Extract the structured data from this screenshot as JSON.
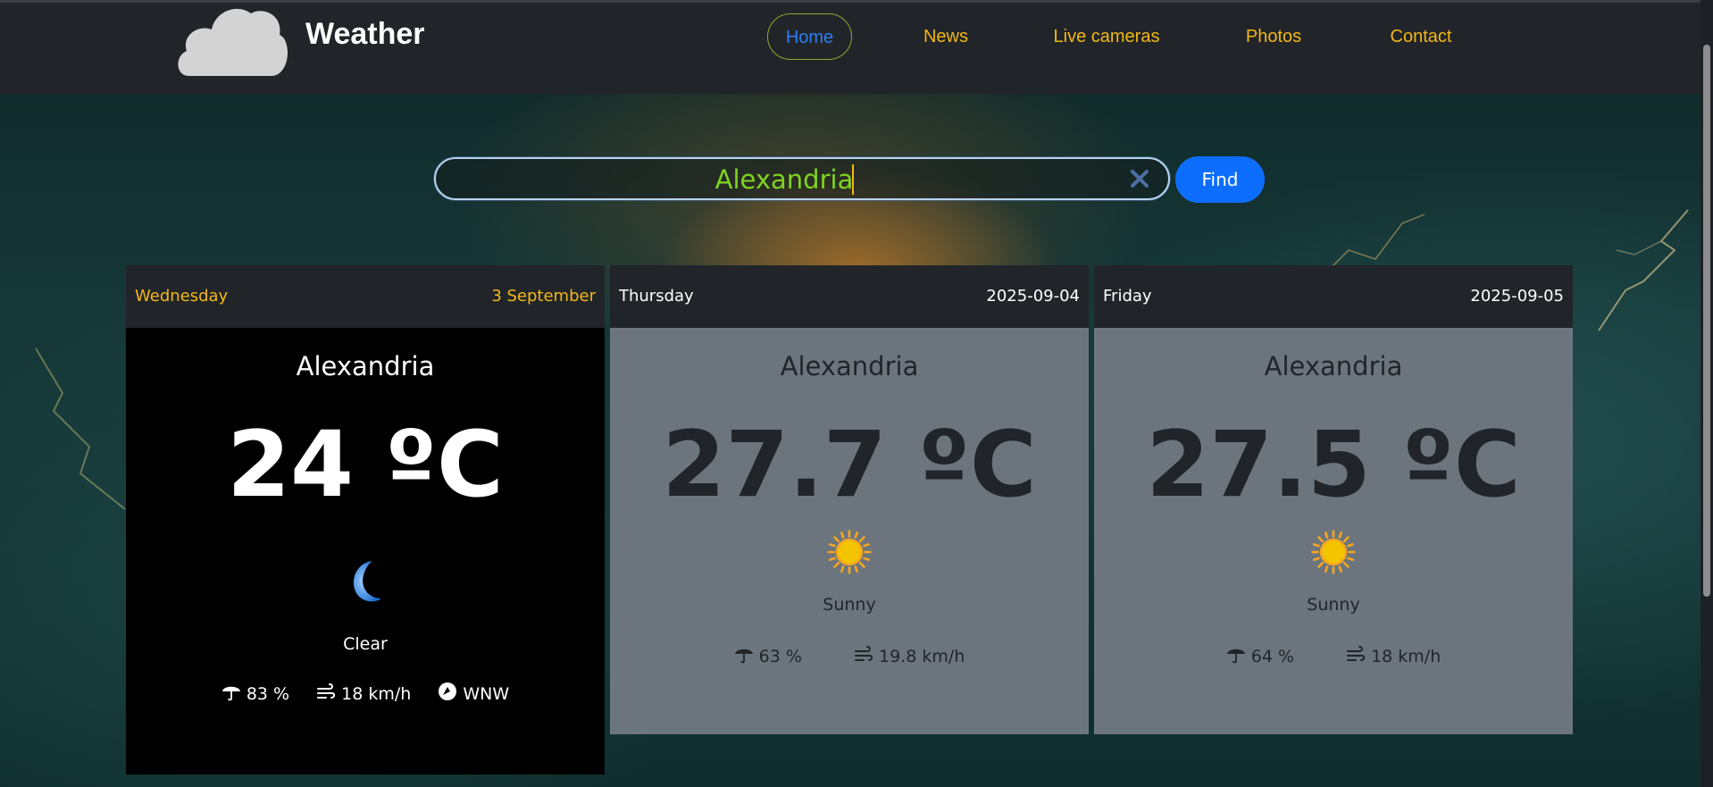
{
  "brand": {
    "name": "Weather",
    "logo_icon": "cloud-icon"
  },
  "nav": {
    "items": [
      {
        "label": "Home",
        "active": true
      },
      {
        "label": "News",
        "active": false
      },
      {
        "label": "Live cameras",
        "active": false
      },
      {
        "label": "Photos",
        "active": false
      },
      {
        "label": "Contact",
        "active": false
      }
    ]
  },
  "search": {
    "value": "Alexandria",
    "clear_icon": "close-icon",
    "button_label": "Find"
  },
  "forecast": [
    {
      "day": "Wednesday",
      "date": "3 September",
      "city": "Alexandria",
      "temperature": "24 ºC",
      "icon": "moon-icon",
      "condition": "Clear",
      "humidity": "83 %",
      "wind_speed": "18 km/h",
      "wind_direction": "WNW"
    },
    {
      "day": "Thursday",
      "date": "2025-09-04",
      "city": "Alexandria",
      "temperature": "27.7 ºC",
      "icon": "sun-icon",
      "condition": "Sunny",
      "humidity": "63 %",
      "wind_speed": "19.8 km/h"
    },
    {
      "day": "Friday",
      "date": "2025-09-05",
      "city": "Alexandria",
      "temperature": "27.5 ºC",
      "icon": "sun-icon",
      "condition": "Sunny",
      "humidity": "64 %",
      "wind_speed": "18 km/h"
    }
  ],
  "colors": {
    "navbar": "#212529",
    "nav_link": "#f3b716",
    "nav_active": "#2d7cf6",
    "search_text": "#7ed321",
    "find_button": "#0d6efd",
    "today_card": "#000000",
    "other_card": "#6c757d"
  }
}
